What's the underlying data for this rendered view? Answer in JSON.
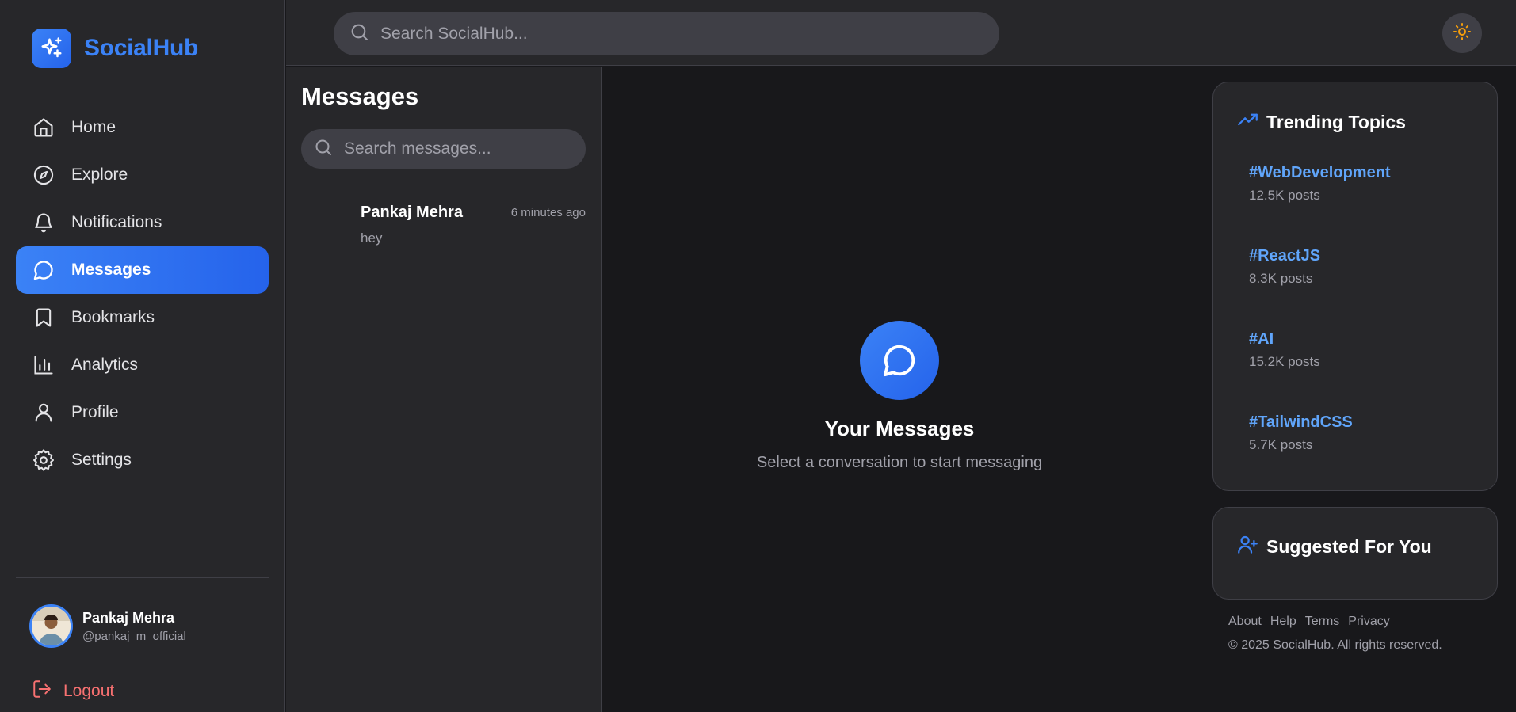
{
  "brand": {
    "name": "SocialHub"
  },
  "sidebar": {
    "items": [
      {
        "label": "Home",
        "icon": "home-icon"
      },
      {
        "label": "Explore",
        "icon": "compass-icon"
      },
      {
        "label": "Notifications",
        "icon": "bell-icon"
      },
      {
        "label": "Messages",
        "icon": "message-circle-icon",
        "active": true
      },
      {
        "label": "Bookmarks",
        "icon": "bookmark-icon"
      },
      {
        "label": "Analytics",
        "icon": "bar-chart-icon"
      },
      {
        "label": "Profile",
        "icon": "user-icon"
      },
      {
        "label": "Settings",
        "icon": "gear-icon"
      }
    ],
    "user": {
      "name": "Pankaj Mehra",
      "handle": "@pankaj_m_official"
    },
    "logout_label": "Logout"
  },
  "topbar": {
    "search_placeholder": "Search SocialHub..."
  },
  "conversations": {
    "title": "Messages",
    "search_placeholder": "Search messages...",
    "items": [
      {
        "name": "Pankaj Mehra",
        "time": "6 minutes ago",
        "preview": "hey"
      }
    ]
  },
  "empty_state": {
    "title": "Your Messages",
    "subtitle": "Select a conversation to start messaging"
  },
  "trending": {
    "title": "Trending Topics",
    "topics": [
      {
        "tag": "#WebDevelopment",
        "count": "12.5K posts"
      },
      {
        "tag": "#ReactJS",
        "count": "8.3K posts"
      },
      {
        "tag": "#AI",
        "count": "15.2K posts"
      },
      {
        "tag": "#TailwindCSS",
        "count": "5.7K posts"
      }
    ]
  },
  "suggested": {
    "title": "Suggested For You"
  },
  "footer": {
    "links": [
      "About",
      "Help",
      "Terms",
      "Privacy"
    ],
    "copyright": "© 2025 SocialHub. All rights reserved."
  },
  "colors": {
    "accent": "#3b82f6",
    "accent_light": "#60a5fa",
    "danger": "#f87171",
    "sun": "#f59e0b",
    "background": "#18181b",
    "panel": "#27272a"
  }
}
